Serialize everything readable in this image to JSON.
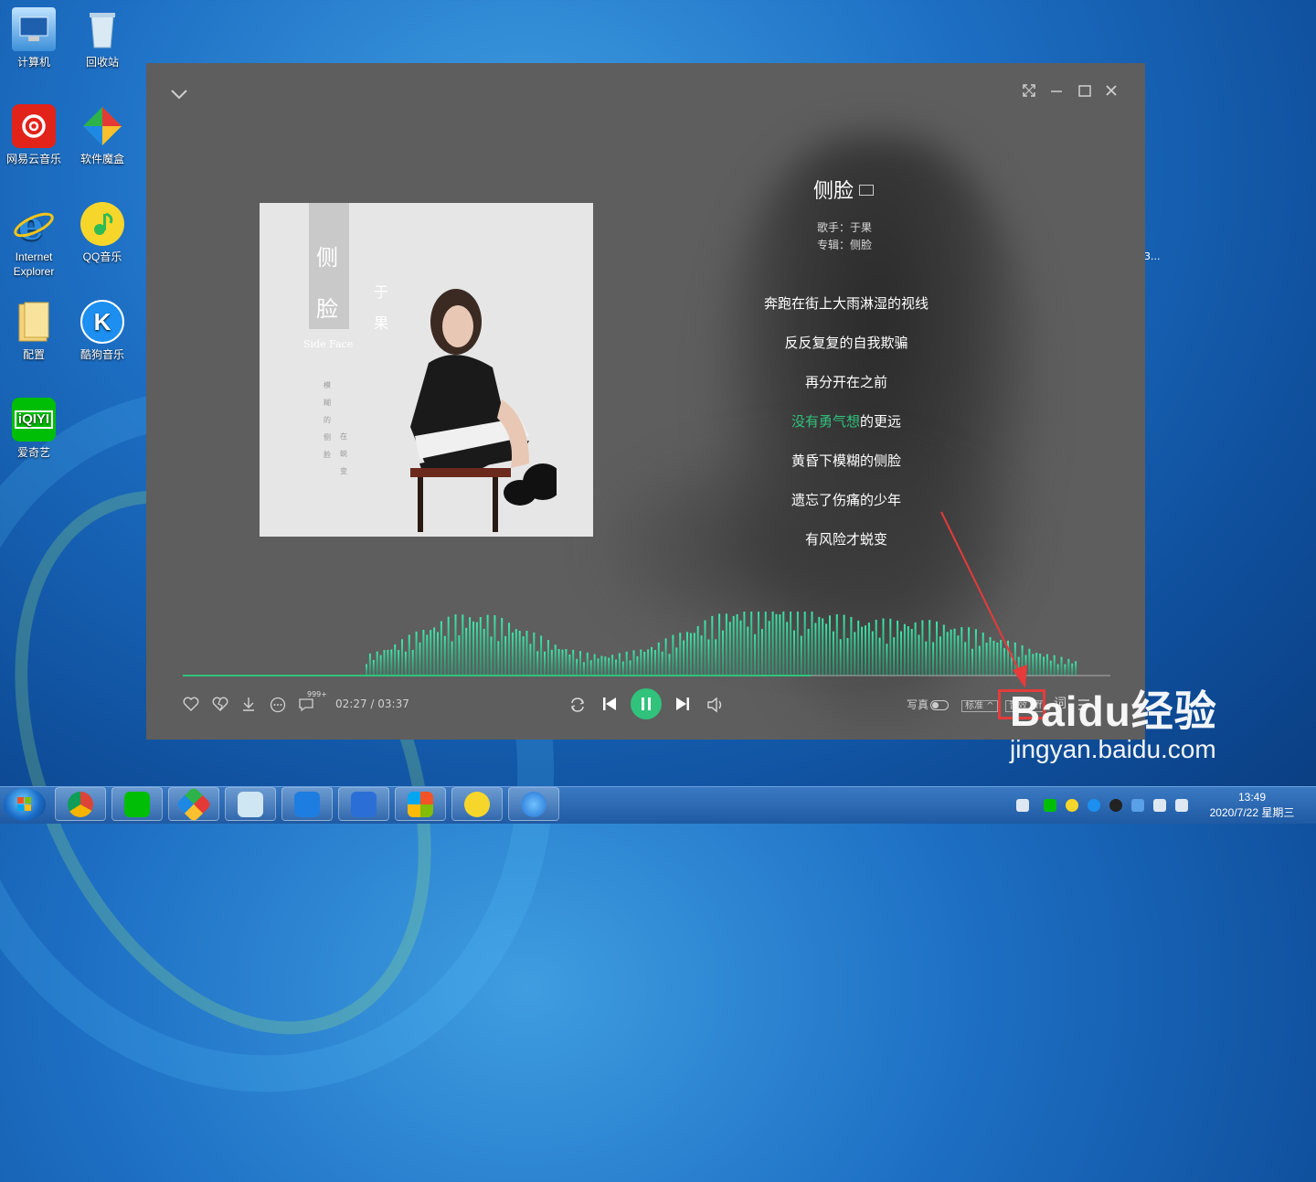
{
  "desktop": {
    "icons": [
      {
        "label": "计算机"
      },
      {
        "label": "回收站"
      },
      {
        "label": "网易云音乐"
      },
      {
        "label": "软件魔盒"
      },
      {
        "label": "Internet Explorer"
      },
      {
        "label": "QQ音乐"
      },
      {
        "label": "配置"
      },
      {
        "label": "酷狗音乐"
      },
      {
        "label": "爱奇艺"
      }
    ],
    "edge_text": "3..."
  },
  "player": {
    "album_art": {
      "title_chars": [
        "侧",
        "脸"
      ],
      "artist_chars": [
        "于",
        "果"
      ],
      "subtitle": "Side Face",
      "vertical_text_1": "模糊的侧脸",
      "vertical_text_2": "在蜕变"
    },
    "song": {
      "title": "侧脸",
      "artist_line": "歌手：于果",
      "album_line": "专辑：侧脸"
    },
    "lyrics": [
      {
        "text": "奔跑在街上大雨淋湿的视线"
      },
      {
        "text": "反反复复的自我欺骗"
      },
      {
        "text": "再分开在之前"
      },
      {
        "highlight": "没有勇气想",
        "rest": "的更远"
      },
      {
        "text": "黄昏下模糊的侧脸"
      },
      {
        "text": "遗忘了伤痛的少年"
      },
      {
        "text": "有风险才蜕变"
      }
    ],
    "progress": {
      "current": "02:27",
      "total": "03:37",
      "fraction": 0.677,
      "display": "02:27 / 03:37"
    },
    "comment_count": "999+",
    "right_controls": {
      "photo_label": "写真",
      "quality_label": "标准",
      "effect_label": "音效 off",
      "lyrics_label": "词"
    },
    "accent_color": "#31c27c"
  },
  "watermark": {
    "brand": "Baidu经验",
    "url": "jingyan.baidu.com"
  },
  "taskbar": {
    "clock_time": "13:49",
    "clock_date": "2020/7/22 星期三"
  }
}
